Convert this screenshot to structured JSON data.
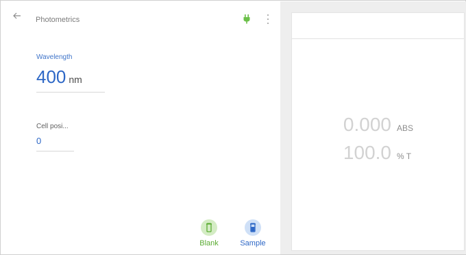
{
  "header": {
    "title": "Photometrics"
  },
  "wavelength": {
    "label": "Wavelength",
    "value": "400",
    "unit": "nm"
  },
  "cell_position": {
    "label": "Cell posi...",
    "value": "0"
  },
  "actions": {
    "blank_label": "Blank",
    "sample_label": "Sample"
  },
  "readout": {
    "abs_value": "0.000",
    "abs_unit": "ABS",
    "t_value": "100.0",
    "t_unit": "% T"
  },
  "colors": {
    "accent_blue": "#2d67c6",
    "blank_green": "#5aab32",
    "plug_green": "#6cc04a"
  },
  "icons": [
    "back-arrow-icon",
    "plug-icon",
    "more-vert-icon",
    "blank-cuvette-icon",
    "sample-cuvette-icon"
  ]
}
